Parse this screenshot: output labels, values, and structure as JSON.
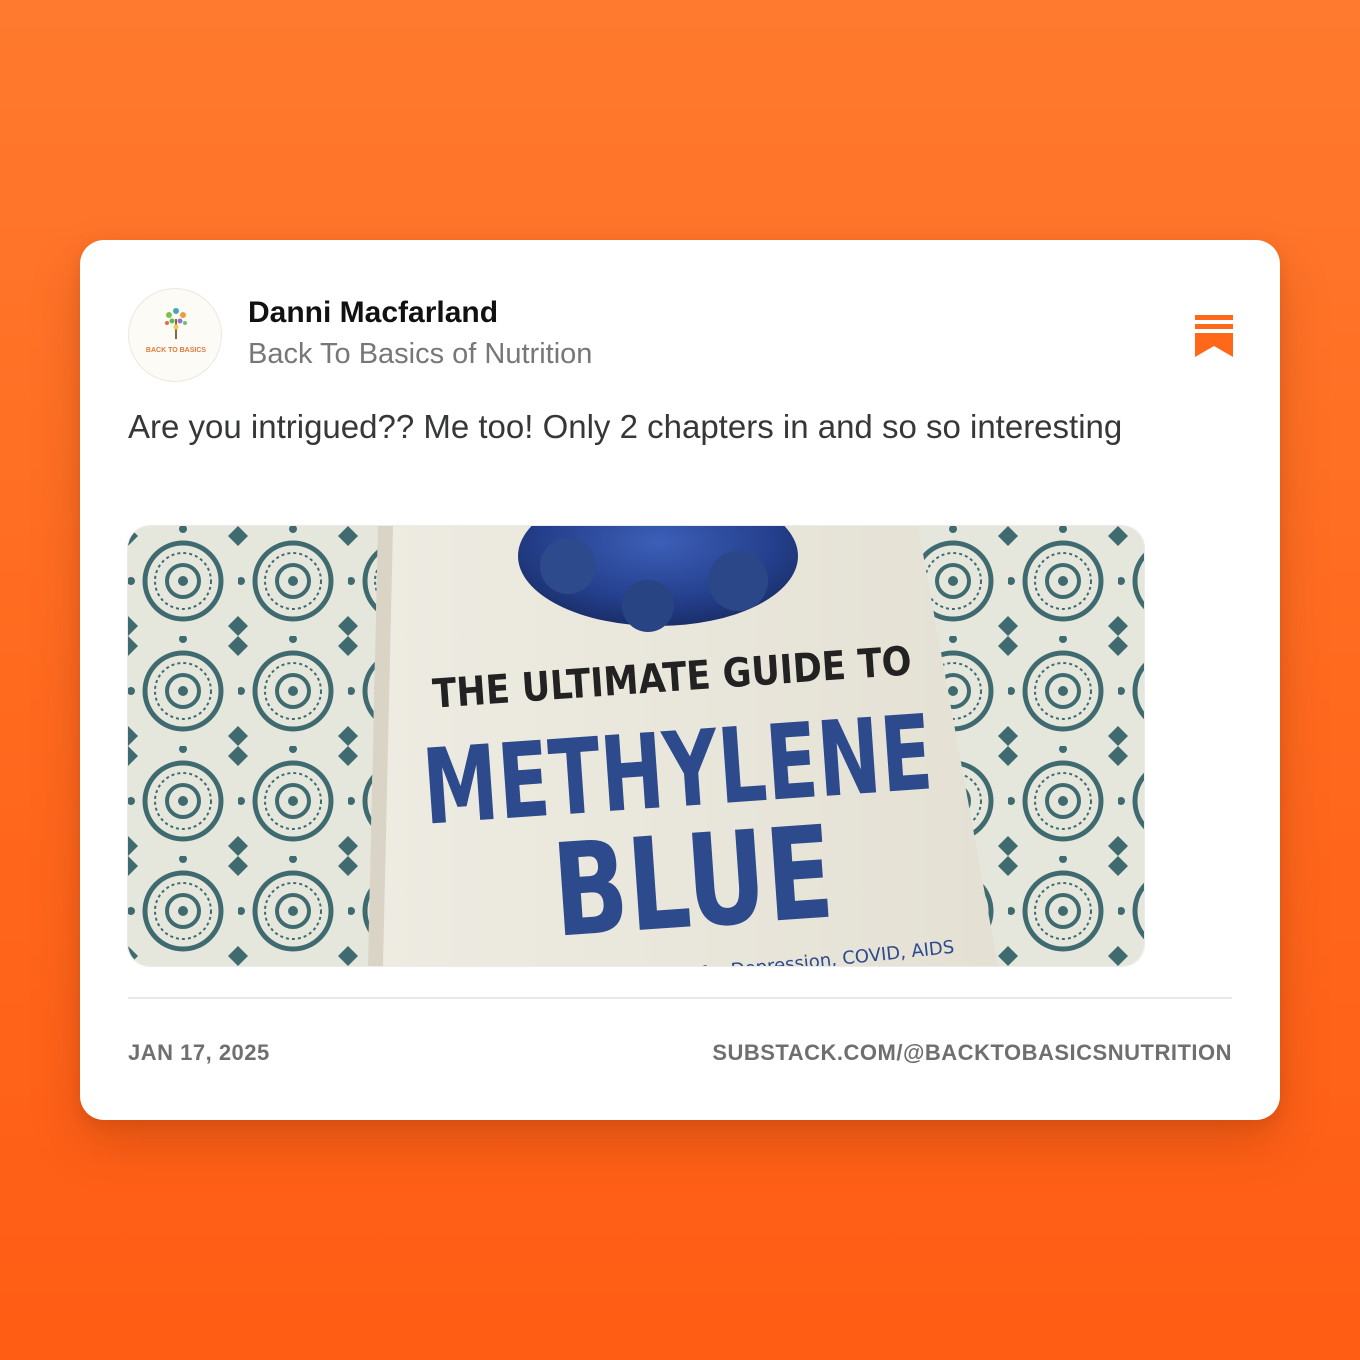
{
  "author": {
    "name": "Danni Macfarland",
    "publication": "Back To Basics of Nutrition",
    "avatar_logo_text": "BACK TO BASICS"
  },
  "post": {
    "text": "Are you intrigued?? Me too! Only 2 chapters in and so so interesting",
    "image": {
      "subject": "book cover on patterned tablecloth",
      "cover_line1": "THE ULTIMATE GUIDE TO",
      "cover_line2": "METHYLENE",
      "cover_line3": "BLUE",
      "cover_subtitle": "for Depression, COVID, AIDS"
    }
  },
  "footer": {
    "date": "JAN 17, 2025",
    "url": "SUBSTACK.COM/@BACKTOBASICSNUTRITION"
  },
  "icons": {
    "bookmark": "substack-bookmark-icon"
  },
  "colors": {
    "background_top": "#ff7a2e",
    "background_bottom": "#ff5c14",
    "accent": "#ff6719",
    "cover_blue": "#2c4a8c",
    "pattern_teal": "#3f6b70"
  }
}
